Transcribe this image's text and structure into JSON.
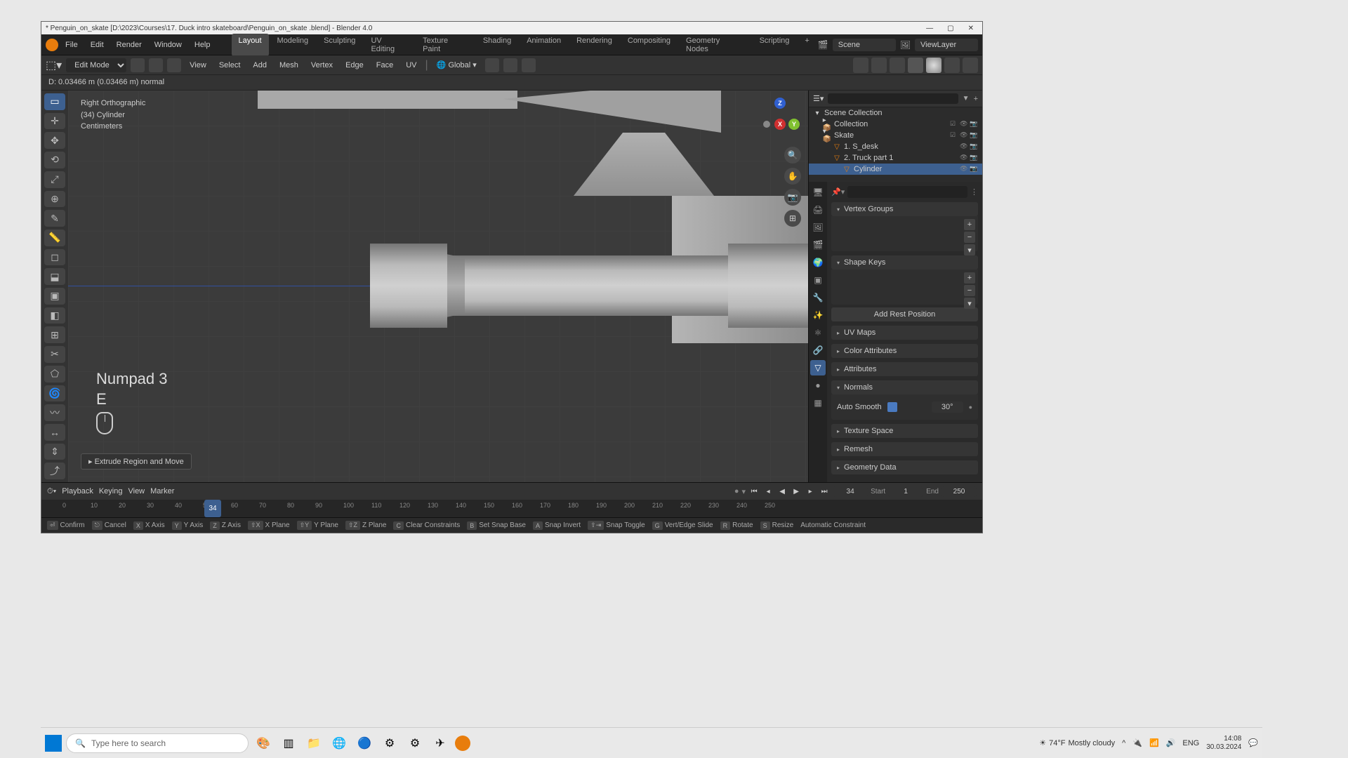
{
  "window": {
    "title": "* Penguin_on_skate  [D:\\2023\\Courses\\17. Duck intro skateboard\\Penguin_on_skate .blend] - Blender 4.0"
  },
  "menubar": {
    "items": [
      "File",
      "Edit",
      "Render",
      "Window",
      "Help"
    ],
    "workspaces": [
      "Layout",
      "Modeling",
      "Sculpting",
      "UV Editing",
      "Texture Paint",
      "Shading",
      "Animation",
      "Rendering",
      "Compositing",
      "Geometry Nodes",
      "Scripting"
    ],
    "active_workspace": "Layout",
    "scene": "Scene",
    "viewlayer": "ViewLayer"
  },
  "toolbar2": {
    "mode": "Edit Mode",
    "menus": [
      "View",
      "Select",
      "Add",
      "Mesh",
      "Vertex",
      "Edge",
      "Face",
      "UV"
    ],
    "orientation": "Global"
  },
  "status_line": "D: 0.03466 m (0.03466 m) normal",
  "viewport": {
    "overlay": {
      "view": "Right Orthographic",
      "object": "(34) Cylinder",
      "units": "Centimeters"
    },
    "keys": {
      "k1": "Numpad 3",
      "k2": "E"
    },
    "op_label": "Extrude Region and Move",
    "gizmo": {
      "x": "X",
      "y": "Y",
      "z": "Z"
    }
  },
  "outliner": {
    "search_placeholder": "",
    "items": [
      {
        "label": "Scene Collection",
        "indent": 0,
        "icon": "📁"
      },
      {
        "label": "Collection",
        "indent": 1,
        "icon": "📦"
      },
      {
        "label": "Skate",
        "indent": 1,
        "icon": "📦"
      },
      {
        "label": "1. S_desk",
        "indent": 2,
        "icon": "▽"
      },
      {
        "label": "2. Truck part 1",
        "indent": 2,
        "icon": "▽"
      },
      {
        "label": "Cylinder",
        "indent": 3,
        "icon": "▽",
        "selected": true
      }
    ]
  },
  "properties": {
    "sections": {
      "vertex_groups": "Vertex Groups",
      "shape_keys": "Shape Keys",
      "add_rest": "Add Rest Position",
      "uv_maps": "UV Maps",
      "color_attributes": "Color Attributes",
      "attributes": "Attributes",
      "normals": "Normals",
      "auto_smooth": "Auto Smooth",
      "auto_smooth_value": "30°",
      "texture_space": "Texture Space",
      "remesh": "Remesh",
      "geometry_data": "Geometry Data"
    }
  },
  "timeline": {
    "menus": [
      "Playback",
      "Keying",
      "View",
      "Marker"
    ],
    "current_frame": "34",
    "start_label": "Start",
    "start": "1",
    "end_label": "End",
    "end": "250",
    "ticks": [
      "0",
      "10",
      "20",
      "30",
      "40",
      "50",
      "60",
      "70",
      "80",
      "90",
      "100",
      "110",
      "120",
      "130",
      "140",
      "150",
      "160",
      "170",
      "180",
      "190",
      "200",
      "210",
      "220",
      "230",
      "240",
      "250"
    ]
  },
  "statusbar": {
    "items": [
      {
        "key": "⏎",
        "label": "Confirm"
      },
      {
        "key": "⎋",
        "label": "Cancel"
      },
      {
        "key": "X",
        "label": "X Axis"
      },
      {
        "key": "Y",
        "label": "Y Axis"
      },
      {
        "key": "Z",
        "label": "Z Axis"
      },
      {
        "key": "⇧X",
        "label": "X Plane"
      },
      {
        "key": "⇧Y",
        "label": "Y Plane"
      },
      {
        "key": "⇧Z",
        "label": "Z Plane"
      },
      {
        "key": "C",
        "label": "Clear Constraints"
      },
      {
        "key": "B",
        "label": "Set Snap Base"
      },
      {
        "key": "A",
        "label": "Snap Invert"
      },
      {
        "key": "⇧⇥",
        "label": "Snap Toggle"
      },
      {
        "key": "G",
        "label": "Vert/Edge Slide"
      },
      {
        "key": "R",
        "label": "Rotate"
      },
      {
        "key": "S",
        "label": "Resize"
      },
      {
        "key": "",
        "label": "Automatic Constraint"
      }
    ]
  },
  "taskbar": {
    "search_placeholder": "Type here to search",
    "weather_temp": "74°F",
    "weather_cond": "Mostly cloudy",
    "lang": "ENG",
    "time": "14:08",
    "date": "30.03.2024"
  }
}
